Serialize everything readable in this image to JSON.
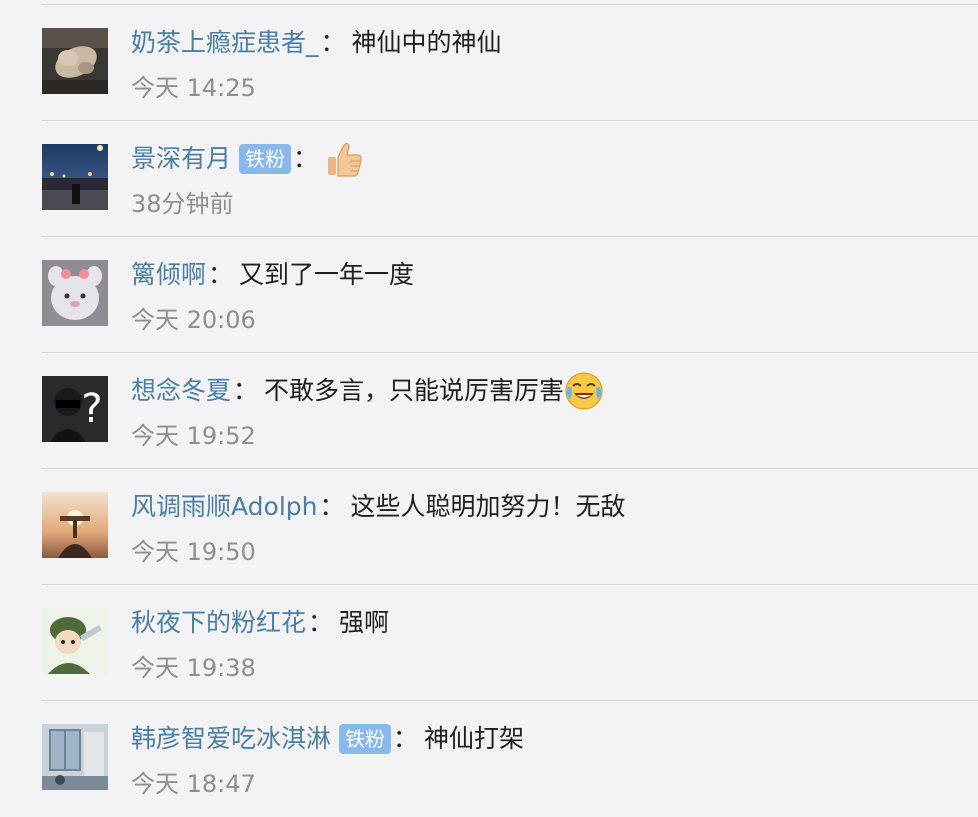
{
  "comments": [
    {
      "username": "奶茶上瘾症患者_",
      "badge": "",
      "text": "神仙中的神仙",
      "emoji_icon": "",
      "time": "今天 14:25",
      "avatar_icon": "cat-avatar-icon"
    },
    {
      "username": "景深有月",
      "badge": "铁粉",
      "text": "",
      "emoji_icon": "thumbs-up-icon",
      "time": "38分钟前",
      "avatar_icon": "night-street-avatar-icon"
    },
    {
      "username": "篱倾啊",
      "badge": "",
      "text": "又到了一年一度",
      "emoji_icon": "",
      "time": "今天 20:06",
      "avatar_icon": "plush-toy-avatar-icon"
    },
    {
      "username": "想念冬夏",
      "badge": "",
      "text": "不敢多言，只能说厉害厉害",
      "emoji_icon": "laughing-crying-icon",
      "time": "今天 19:52",
      "avatar_icon": "question-mark-person-avatar-icon"
    },
    {
      "username": "风调雨顺Adolph",
      "badge": "",
      "text": "这些人聪明加努力！无敌",
      "emoji_icon": "",
      "time": "今天 19:50",
      "avatar_icon": "sunset-tree-avatar-icon"
    },
    {
      "username": "秋夜下的粉红花",
      "badge": "",
      "text": "强啊",
      "emoji_icon": "",
      "time": "今天 19:38",
      "avatar_icon": "soldier-cartoon-avatar-icon"
    },
    {
      "username": "韩彦智爱吃冰淇淋",
      "badge": "铁粉",
      "text": "神仙打架",
      "emoji_icon": "",
      "time": "今天 18:47",
      "avatar_icon": "window-room-avatar-icon"
    }
  ],
  "colon": "：",
  "colors": {
    "username": "#4a7fa3",
    "badge_bg": "#88b8ec",
    "time": "#8e8e93",
    "background": "#f3f3f5",
    "divider": "#d8d8dc"
  }
}
